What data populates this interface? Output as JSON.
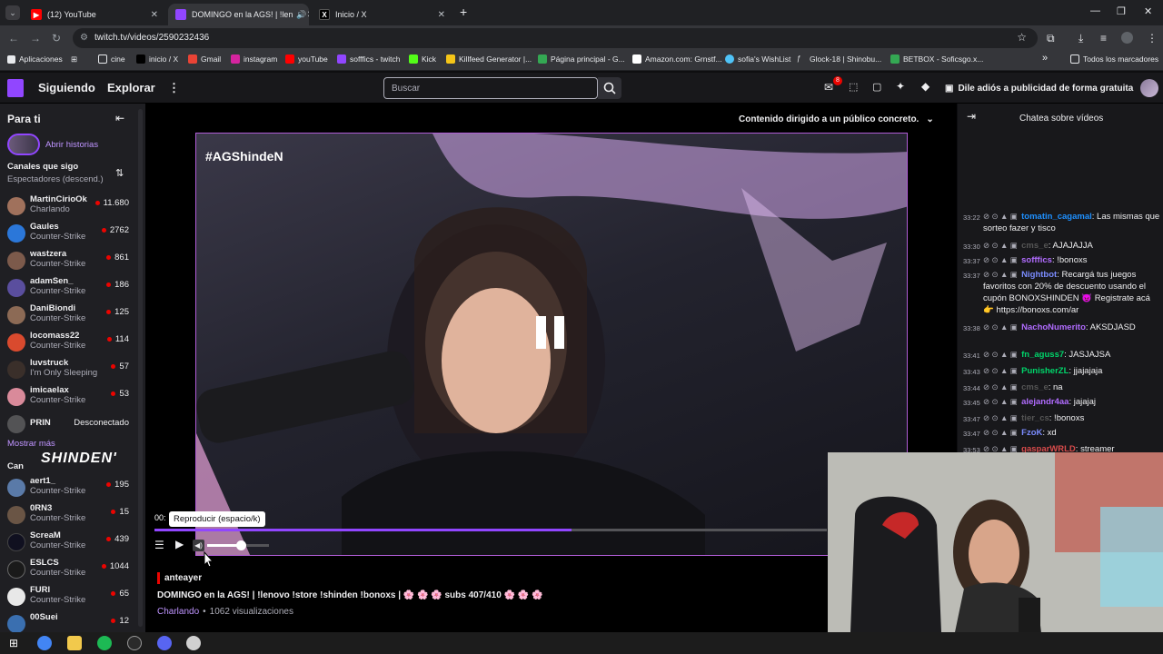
{
  "browser": {
    "tabs": [
      {
        "title": "(12) YouTube",
        "active": false
      },
      {
        "title": "DOMINGO en la AGS! | !len",
        "active": true
      },
      {
        "title": "Inicio / X",
        "active": false
      }
    ],
    "url": "twitch.tv/videos/2590232436",
    "bookmarks": [
      "Aplicaciones",
      "cine",
      "inicio / X",
      "Gmail",
      "instagram",
      "youTube",
      "sofffics - twitch",
      "Kick",
      "Killfeed Generator |...",
      "Página principal - G...",
      "Amazon.com: Grnstf...",
      "sofia's WishList",
      "Glock-18 | Shinobu...",
      "BETBOX - Soficsgo.x..."
    ],
    "bookmarks_more": "»",
    "all_bookmarks": "Todos los marcadores"
  },
  "twitch": {
    "nav": {
      "following": "Siguiendo",
      "browse": "Explorar",
      "more": "⋮",
      "search_placeholder": "Buscar",
      "notif_count": "8",
      "ad_free": "Dile adiós a publicidad de forma gratuita"
    },
    "sidebar": {
      "title": "Para ti",
      "stories": "Abrir historias",
      "following_header": "Canales que sigo",
      "sort_label": "Espectadores (descend.)",
      "channels": [
        {
          "name": "MartinCirioOk",
          "game": "Charlando",
          "viewers": "11.680"
        },
        {
          "name": "Gaules",
          "game": "Counter-Strike",
          "viewers": "2762"
        },
        {
          "name": "wastzera",
          "game": "Counter-Strike",
          "viewers": "861"
        },
        {
          "name": "adamSen_",
          "game": "Counter-Strike",
          "viewers": "186"
        },
        {
          "name": "DaniBiondi",
          "game": "Counter-Strike",
          "viewers": "125"
        },
        {
          "name": "locomass22",
          "game": "Counter-Strike",
          "viewers": "114"
        },
        {
          "name": "luvstruck",
          "game": "I'm Only Sleeping",
          "viewers": "57"
        },
        {
          "name": "imicaelax",
          "game": "Counter-Strike",
          "viewers": "53"
        }
      ],
      "offline_channel": {
        "name": "PRIN",
        "status": "Desconectado"
      },
      "show_more": "Mostrar más",
      "rec_header": "Can",
      "rec_channels": [
        {
          "name": "aert1_",
          "game": "Counter-Strike",
          "viewers": "195"
        },
        {
          "name": "0RN3",
          "game": "Counter-Strike",
          "viewers": "15"
        },
        {
          "name": "ScreaM",
          "game": "Counter-Strike",
          "viewers": "439"
        },
        {
          "name": "ESLCS",
          "game": "Counter-Strike",
          "viewers": "1044"
        },
        {
          "name": "FURI",
          "game": "Counter-Strike",
          "viewers": "65"
        },
        {
          "name": "00Suei",
          "game": "",
          "viewers": "12"
        }
      ]
    },
    "player": {
      "audience_notice": "Contenido dirigido a un público concreto.",
      "overlay_tag": "#AGShindeN",
      "brand_overlay": "SHINDEN'",
      "tooltip": "Reproducir (espacio/k)",
      "time_partial": "00:",
      "progress": 0.62,
      "volume": 0.55
    },
    "video_info": {
      "channel": "anteayer",
      "title": "DOMINGO en la AGS! | !lenovo !store !shinden !bonoxs | 🌸 🌸 🌸 subs 407/410 🌸 🌸 🌸",
      "category": "Charlando",
      "views": "1062 visualizaciones",
      "separator": "•"
    },
    "chat": {
      "title": "Chatea sobre vídeos",
      "messages": [
        {
          "time": "33:22",
          "user": "tomatin_cagamal",
          "color": "#1e90ff",
          "text": ": Las mismas que sorteo fazer y tisco"
        },
        {
          "time": "33:30",
          "user": "cms_e",
          "color": "#555555",
          "text": ": AJAJAJJA"
        },
        {
          "time": "33:37",
          "user": "sofffics",
          "color": "#b16cff",
          "text": ": !bonoxs"
        },
        {
          "time": "33:37",
          "user": "Nightbot",
          "color": "#7b8cff",
          "text": ": Recargá tus juegos favoritos con 20% de descuento usando el cupón BONOXSHINDEN 😈 Registrate acá 👉 https://bonoxs.com/ar"
        },
        {
          "time": "33:38",
          "user": "NachoNumerito",
          "color": "#b16cff",
          "text": ": AKSDJASD"
        },
        {
          "time": "33:41",
          "user": "fn_aguss7",
          "color": "#00d46a",
          "text": ": JASJAJSA"
        },
        {
          "time": "33:43",
          "user": "PunisherZL",
          "color": "#00d46a",
          "text": ": jjajajaja"
        },
        {
          "time": "33:44",
          "user": "cms_e",
          "color": "#555555",
          "text": ": na"
        },
        {
          "time": "33:45",
          "user": "alejandr4aa",
          "color": "#b16cff",
          "text": ": jajajaj"
        },
        {
          "time": "33:47",
          "user": "tier_cs",
          "color": "#555555",
          "text": ": !bonoxs"
        },
        {
          "time": "33:47",
          "user": "FzoK",
          "color": "#7b8cff",
          "text": ": xd"
        },
        {
          "time": "33:53",
          "user": "gasparWRLD",
          "color": "#d94b4b",
          "text": ": streamer"
        }
      ]
    }
  }
}
